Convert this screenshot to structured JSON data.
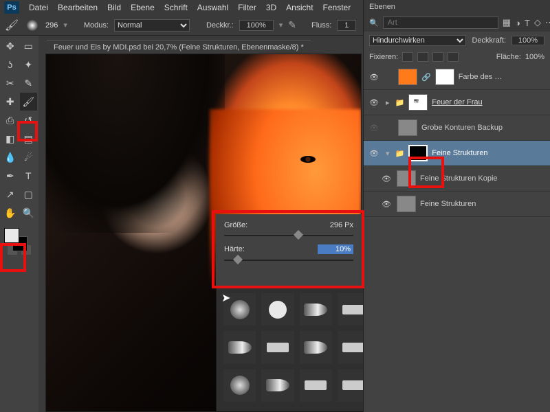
{
  "menu": {
    "items": [
      "Datei",
      "Bearbeiten",
      "Bild",
      "Ebene",
      "Schrift",
      "Auswahl",
      "Filter",
      "3D",
      "Ansicht",
      "Fenster"
    ],
    "ps": "Ps"
  },
  "options": {
    "brush_size": "296",
    "mode_label": "Modus:",
    "mode_value": "Normal",
    "opacity_label": "Deckkr.:",
    "opacity_value": "100%",
    "flow_label": "Fluss:",
    "flow_value": "1"
  },
  "doc": {
    "tab": "Feuer und Eis by MDI.psd bei 20,7% (Feine Strukturen, Ebenenmaske/8) *"
  },
  "brush_popup": {
    "size_label": "Größe:",
    "size_value": "296 Px",
    "hardness_label": "Härte:",
    "hardness_value": "10%"
  },
  "layers_panel": {
    "title": "Ebenen",
    "search_placeholder": "Art",
    "blend_mode": "Hindurchwirken",
    "opacity_label": "Deckkraft:",
    "opacity_value": "100%",
    "lock_label": "Fixieren:",
    "fill_label": "Fläche:",
    "fill_value": "100%",
    "layers": [
      {
        "name": "Farbe des …",
        "kind": "fill",
        "color": "#ff7a1a",
        "mask": true,
        "link": false
      },
      {
        "name": "Feuer der Frau",
        "kind": "group",
        "link": true
      },
      {
        "name": "Grobe Konturen Backup",
        "kind": "pixel",
        "thumb": "checker"
      },
      {
        "name": "Feine Strukturen",
        "kind": "group-mask",
        "selected": true
      },
      {
        "name": "Feine Strukturen Kopie",
        "kind": "pixel",
        "thumb": "checker"
      },
      {
        "name": "Feine Strukturen",
        "kind": "pixel",
        "thumb": "checker"
      }
    ]
  },
  "icons": {
    "search": "⌕",
    "image": "▦",
    "adjust": "◑",
    "text": "T",
    "shape": "◇",
    "fx": "⋯",
    "eye": "👁",
    "folder": "📁",
    "lock": "🔒",
    "link": "🔗"
  }
}
